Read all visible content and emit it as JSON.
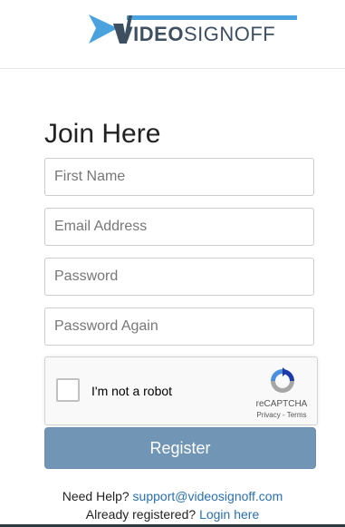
{
  "header": {
    "logo_text_bold": "VIDEO",
    "logo_text_normal": "SIGNOFF",
    "brand_colors": {
      "arrow": "#4aa3df",
      "text": "#3d4f60"
    }
  },
  "form": {
    "title": "Join Here",
    "fields": [
      {
        "name": "first-name",
        "placeholder": "First Name",
        "value": ""
      },
      {
        "name": "email",
        "placeholder": "Email Address",
        "value": ""
      },
      {
        "name": "password",
        "placeholder": "Password",
        "value": ""
      },
      {
        "name": "password-again",
        "placeholder": "Password Again",
        "value": ""
      }
    ],
    "captcha": {
      "label": "I'm not a robot",
      "brand": "reCAPTCHA",
      "links": "Privacy - Terms",
      "checked": false
    },
    "register_label": "Register",
    "register_color": "#7195b5"
  },
  "footer": {
    "help_prefix": "Need Help?",
    "help_email": "support@videosignoff.com",
    "login_prefix": "Already registered?",
    "login_link": "Login here",
    "link_color": "#2a6fb0"
  }
}
